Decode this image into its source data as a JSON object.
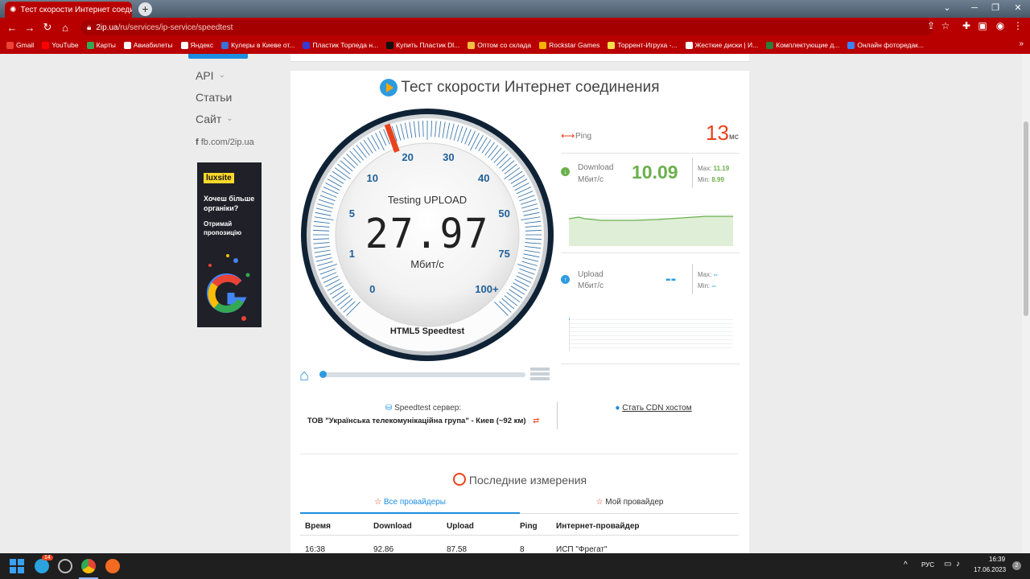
{
  "browser": {
    "tab_title": "Тест скорости Интернет соедин...",
    "tab_close": "✕",
    "new_tab": "+",
    "url_host": "2ip.ua",
    "url_path": "/ru/services/ip-service/speedtest",
    "window_controls": [
      "⌄",
      "─",
      "❐",
      "✕"
    ],
    "bookmarks": [
      {
        "label": "Gmail",
        "color": "#ea4335"
      },
      {
        "label": "YouTube",
        "color": "#ff0000"
      },
      {
        "label": "Карты",
        "color": "#34a853"
      },
      {
        "label": "Авиабилеты",
        "color": "#ffffff"
      },
      {
        "label": "Яндекс",
        "color": "#ffffff"
      },
      {
        "label": "Кулеры в Киеве от...",
        "color": "#3b6fd8"
      },
      {
        "label": "Пластик Торпеда н...",
        "color": "#3a3ad0"
      },
      {
        "label": "Купить Пластик Dl...",
        "color": "#111111"
      },
      {
        "label": "Оптом со склада",
        "color": "#f0c040"
      },
      {
        "label": "Rockstar Games",
        "color": "#f4b400"
      },
      {
        "label": "Торрент-Игруха -...",
        "color": "#f1e04b"
      },
      {
        "label": "Жесткие диски | И...",
        "color": "#ffffff"
      },
      {
        "label": "Комплектующие д...",
        "color": "#2f7d3a"
      },
      {
        "label": "Онлайн фоторедак...",
        "color": "#3b82f6"
      }
    ],
    "more_bookmarks": "»"
  },
  "sidebar": {
    "items": [
      {
        "label": "API",
        "chev": "⌄"
      },
      {
        "label": "Статьи",
        "chev": ""
      },
      {
        "label": "Сайт",
        "chev": "⌄"
      }
    ],
    "fb_link": "fb.com/2ip.ua",
    "ad": {
      "brand": "luxsite",
      "headline": "Хочеш більше органіки?",
      "cta": "Отримай пропозицію"
    }
  },
  "speedtest": {
    "title": "Тест скорости Интернет соединения",
    "state": "Testing UPLOAD",
    "reading": "27.97",
    "unit": "Мбит/с",
    "engine": "HTML5 Speedtest",
    "gauge_labels": [
      "0",
      "1",
      "5",
      "10",
      "20",
      "30",
      "40",
      "50",
      "75",
      "100+"
    ],
    "needle_value_label": "20",
    "ping": {
      "label": "Ping",
      "value": "13",
      "unit": "мс"
    },
    "download": {
      "label": "Download",
      "unit": "Мбит/с",
      "value": "10.09",
      "max_label": "Max:",
      "max": "11.19",
      "min_label": "Min:",
      "min": "8.99"
    },
    "upload": {
      "label": "Upload",
      "unit": "Мбит/с",
      "value": "--",
      "max_label": "Max:",
      "max": "--",
      "min_label": "Min:",
      "min": "--"
    },
    "progress": 0.0,
    "server_label": "Speedtest сервер:",
    "server_name": "ТОВ \"Українська телекомунікаційна група\" - Киев (~92 км)",
    "cdn_link": "Стать CDN хостом"
  },
  "recent": {
    "title": "Последние измерения",
    "tabs": [
      "Все провайдеры",
      "Мой провайдер"
    ],
    "columns": [
      "Время",
      "Download",
      "Upload",
      "Ping",
      "Интернет-провайдер"
    ],
    "rows": [
      [
        "16:38",
        "92.86",
        "87.58",
        "8",
        "ИСП \"Фрегат\""
      ]
    ]
  },
  "taskbar": {
    "badge": "14",
    "tray_arrow": "^",
    "lang": "РУС",
    "time": "16:39",
    "date": "17.06.2023",
    "notif": "2"
  },
  "colors": {
    "accent": "#1d8de0",
    "chrome": "#b90000",
    "ping": "#e8431c",
    "download": "#6ab04c",
    "upload": "#2d9be0"
  }
}
